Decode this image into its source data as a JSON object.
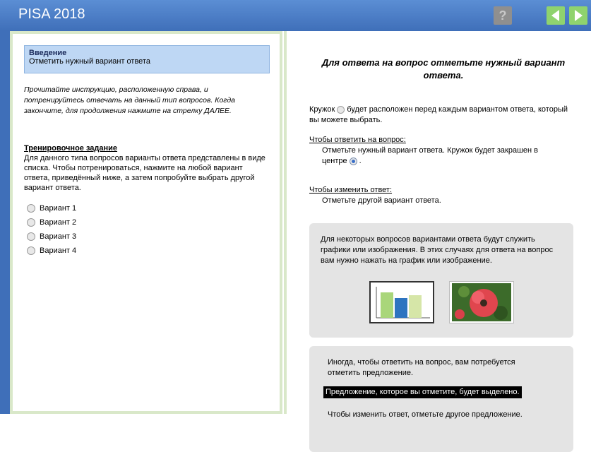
{
  "app": {
    "title": "PISA 2018"
  },
  "toolbar": {
    "help_label": "?"
  },
  "left": {
    "intro_title": "Введение",
    "intro_subtitle": "Отметить нужный вариант ответа",
    "instruction": "Прочитайте инструкцию, расположенную справа, и потренируйтесь отвечать на данный тип вопросов. Когда закончите, для продолжения нажмите на стрелку ДАЛЕЕ.",
    "training_title": "Тренировочное задание",
    "training_text": "Для данного типа вопросов варианты ответа представлены в виде списка. Чтобы потренироваться, нажмите на любой вариант ответа, приведённый ниже, а затем попробуйте выбрать другой вариант ответа.",
    "options": [
      "Вариант 1",
      "Вариант 2",
      "Вариант 3",
      "Вариант 4"
    ]
  },
  "right": {
    "headline": "Для ответа на вопрос отметьте нужный вариант ответа.",
    "circle_pre": "Кружок",
    "circle_post": "будет расположен перед каждым вариантом ответа, который вы можете выбрать.",
    "answer_heading": "Чтобы ответить на вопрос:",
    "answer_text": "Отметьте нужный вариант ответа. Кружок будет закрашен в центре",
    "answer_tail": ".",
    "change_heading": "Чтобы изменить ответ:",
    "change_text": "Отметьте другой вариант ответа.",
    "images_text": "Для некоторых вопросов вариантами ответа будут служить графики или изображения. В этих случаях для ответа на вопрос вам нужно нажать на график или изображение.",
    "sentence_text": "Иногда, чтобы ответить на вопрос, вам потребуется отметить предложение.",
    "highlighted_sentence": "Предложение, которое вы отметите, будет выделено.",
    "change_sentence_text": "Чтобы изменить ответ, отметьте другое предложение."
  },
  "colors": {
    "header": "#4a7ec7",
    "panel_border": "#d9e8c9",
    "intro_bg": "#bed7f4",
    "nav_green": "#8fd36e"
  },
  "icons": {
    "help": "help-icon",
    "back": "arrow-left-icon",
    "next": "arrow-right-icon"
  }
}
